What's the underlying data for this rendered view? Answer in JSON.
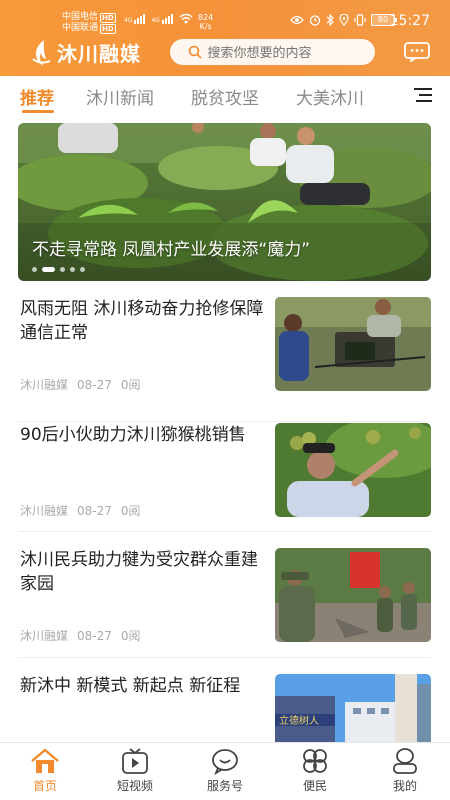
{
  "status_bar": {
    "carrier_1": "中国电信",
    "carrier_2": "中国联通",
    "hd_badge": "HD",
    "network_label": "4G",
    "speed_value": "824",
    "speed_unit": "K/s",
    "battery": "80",
    "time": "15:27"
  },
  "header": {
    "app_name": "沐川融媒",
    "search_placeholder": "搜索你想要的内容",
    "accent_color": "#f08a2c"
  },
  "tabs": [
    {
      "label": "推荐",
      "active": true
    },
    {
      "label": "沐川新闻",
      "active": false
    },
    {
      "label": "脱贫攻坚",
      "active": false
    },
    {
      "label": "大美沐川",
      "active": false
    }
  ],
  "banner": {
    "caption": "不走寻常路   凤凰村产业发展添“魔力”",
    "slide_count": 5,
    "active_slide": 2
  },
  "news": [
    {
      "title": "风雨无阻 沐川移动奋力抢修保障通信正常",
      "source": "沐川融媒",
      "date": "08-27",
      "reads": "0阅"
    },
    {
      "title": "90后小伙助力沐川猕猴桃销售",
      "source": "沐川融媒",
      "date": "08-27",
      "reads": "0阅"
    },
    {
      "title": "沐川民兵助力犍为受灾群众重建家园",
      "source": "沐川融媒",
      "date": "08-27",
      "reads": "0阅"
    },
    {
      "title": "新沐中 新模式 新起点 新征程",
      "source": "",
      "date": "",
      "reads": ""
    }
  ],
  "bottom_nav": [
    {
      "label": "首页",
      "icon": "home-icon",
      "active": true
    },
    {
      "label": "短视频",
      "icon": "video-icon",
      "active": false
    },
    {
      "label": "服务号",
      "icon": "service-icon",
      "active": false
    },
    {
      "label": "便民",
      "icon": "clover-icon",
      "active": false
    },
    {
      "label": "我的",
      "icon": "user-icon",
      "active": false
    }
  ]
}
